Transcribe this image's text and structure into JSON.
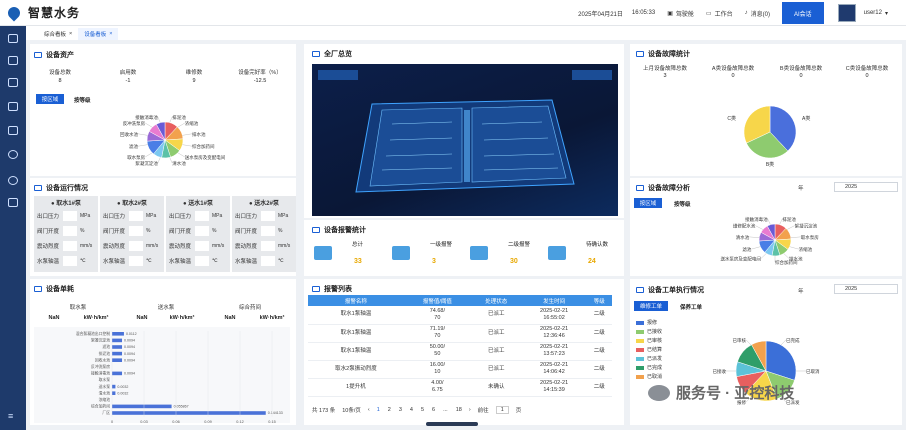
{
  "header": {
    "title": "智慧水务",
    "datetime": "2025年04月21日",
    "time": "16:05:33",
    "cockpit": "驾驶舱",
    "workbench": "工作台",
    "message": "消息(0)",
    "ai": "AI会话",
    "user": "user12"
  },
  "tabs": [
    {
      "label": "综合看板"
    },
    {
      "label": "设备看板"
    }
  ],
  "assets": {
    "title": "设备资产",
    "labels": [
      "设备总数",
      "启用数",
      "维修数",
      "设备完好率（%）"
    ],
    "values": [
      "8",
      "-1",
      "9",
      "-12.5"
    ],
    "btn_active": "按区域",
    "btn_other": "按等级",
    "pie": {
      "slices": [
        {
          "label": "絮凝沉淀池",
          "color": "#e85f5f",
          "value": 12
        },
        {
          "label": "取水泵房",
          "color": "#f2a14d",
          "value": 12
        },
        {
          "label": "清水池",
          "color": "#f7d64a",
          "value": 11
        },
        {
          "label": "排泥池",
          "color": "#8ecb6f",
          "value": 10
        },
        {
          "label": "回收水池",
          "color": "#5cc2a8",
          "value": 8
        },
        {
          "label": "浓缩池",
          "color": "#7cc8f0",
          "value": 8
        },
        {
          "label": "滤池",
          "color": "#4a7ee6",
          "value": 13
        },
        {
          "label": "综合加药间",
          "color": "#9a6ad6",
          "value": 9
        },
        {
          "label": "送水泵房及变配电间",
          "color": "#e87bd0",
          "value": 9
        },
        {
          "label": "反冲洗泵房",
          "color": "#6a5ad6",
          "value": 8
        }
      ],
      "labels": [
        "排泥池",
        "浓缩池",
        "排水池",
        "综合加药间",
        "送水泵房及变配电间",
        "清水池",
        "絮凝沉淀池",
        "取水泵房",
        "滤池",
        "回收水池",
        "反冲洗泵房",
        "接触消毒池"
      ]
    }
  },
  "ops": {
    "title": "设备运行情况",
    "pumps": [
      {
        "name": "取水1#泵",
        "rows": [
          [
            "出口压力",
            "MPa"
          ],
          [
            "阀门开度",
            "%"
          ],
          [
            "震动烈度",
            "mm/s"
          ],
          [
            "水泵轴温",
            "℃"
          ]
        ]
      },
      {
        "name": "取水2#泵",
        "rows": [
          [
            "出口压力",
            "MPa"
          ],
          [
            "阀门开度",
            "%"
          ],
          [
            "震动烈度",
            "mm/s"
          ],
          [
            "水泵轴温",
            "℃"
          ]
        ]
      },
      {
        "name": "送水1#泵",
        "rows": [
          [
            "出口压力",
            "MPa"
          ],
          [
            "阀门开度",
            "%"
          ],
          [
            "震动烈度",
            "mm/s"
          ],
          [
            "水泵轴温",
            "℃"
          ]
        ]
      },
      {
        "name": "送水2#泵",
        "rows": [
          [
            "出口压力",
            "MPa"
          ],
          [
            "阀门开度",
            "%"
          ],
          [
            "震动烈度",
            "mm/s"
          ],
          [
            "水泵轴温",
            "℃"
          ]
        ]
      }
    ]
  },
  "energy": {
    "title": "设备单耗",
    "groups": [
      "取水泵",
      "送水泵",
      "综合药间"
    ],
    "cols": [
      "NaN",
      "kW·h/km³",
      "NaN",
      "kW·h/km³",
      "NaN",
      "kW·h/km³"
    ],
    "chart_data": {
      "type": "bar",
      "orientation": "horizontal",
      "categories": [
        "混合絮凝池出口控制",
        "絮凝沉淀池",
        "滤池",
        "排泥池",
        "回收水池",
        "反冲洗泵房",
        "接触消毒池",
        "取水泵",
        "送水泵",
        "清水池",
        "浓缩池",
        "综合加药间",
        "厂区"
      ],
      "values": [
        0.0112,
        0.0094,
        0.0094,
        0.0094,
        0.0094,
        0.0,
        0.0094,
        0.0,
        0.0032,
        0.0032,
        0.0,
        0.055867,
        0.144133
      ],
      "labels": [
        "0.0112",
        "0.0094",
        "0.0094",
        "0.0094",
        "0.0094",
        "",
        "0.0094",
        "",
        "0.0032",
        "0.0032",
        "",
        "0.055867",
        "0.144133"
      ],
      "xticks": [
        "0",
        "0.03",
        "0.06",
        "0.09",
        "0.12",
        "0.15"
      ],
      "xlim": [
        0,
        0.15
      ]
    }
  },
  "overview": {
    "title": "全厂总览"
  },
  "alarm_stats": {
    "title": "设备报警统计",
    "items": [
      {
        "label": "总计",
        "value": "33"
      },
      {
        "label": "一级报警",
        "value": "3"
      },
      {
        "label": "二级报警",
        "value": "30"
      },
      {
        "label": "待确认数",
        "value": "24"
      }
    ]
  },
  "alarm_list": {
    "title": "报警列表",
    "headers": [
      "报警名称",
      "报警值/阈值",
      "处理状态",
      "发生时间",
      "等级"
    ],
    "rows": [
      [
        "取水1泵轴温",
        "74.68/\n70",
        "已派工",
        "2025-02-21\n16:55:02",
        "二级"
      ],
      [
        "取水1泵轴温",
        "71.19/\n70",
        "已派工",
        "2025-02-21\n12:36:46",
        "二级"
      ],
      [
        "取水1泵轴温",
        "50.00/\n50",
        "已派工",
        "2025-02-21\n13:57:23",
        "二级"
      ],
      [
        "取水2泵振动烈度",
        "16.00/\n10",
        "已派工",
        "2025-02-21\n14:06:42",
        "二级"
      ],
      [
        "1提升机",
        "4.00/\n6.75",
        "未确认",
        "2025-02-21\n14:15:39",
        "二级"
      ]
    ],
    "total": "共 173 条",
    "pagesize": "10条/页",
    "pages": [
      "1",
      "2",
      "3",
      "4",
      "5",
      "6",
      "...",
      "18"
    ],
    "goto": "前往",
    "page_input": "1",
    "page_unit": "页"
  },
  "fault_stats": {
    "title": "设备故障统计",
    "labels": [
      "上月设备故障总数",
      "A类设备故障总数",
      "B类设备故障总数",
      "C类设备故障总数"
    ],
    "values": [
      "3",
      "0",
      "0",
      "0"
    ],
    "pie": {
      "slices": [
        {
          "label": "A类",
          "color": "#4a6fdc",
          "value": 38
        },
        {
          "label": "B类",
          "color": "#8ecb6f",
          "value": 30
        },
        {
          "label": "C类",
          "color": "#f7d64a",
          "value": 32
        }
      ]
    }
  },
  "fault_analysis": {
    "title": "设备故障分析",
    "year_label": "年",
    "year": "2025",
    "btn_active": "按区域",
    "btn_other": "按等级",
    "pie_labels": [
      "排泥池",
      "絮凝沉淀池",
      "取水泵房",
      "浓缩池",
      "排水池",
      "综合加药间",
      "送水泵房及变配电间",
      "滤池",
      "清水池",
      "维修配水池",
      "接触消毒池"
    ]
  },
  "workorder": {
    "title": "设备工单执行情况",
    "year_label": "年",
    "year": "2025",
    "tab_active": "维修工单",
    "tab_other": "保养工单",
    "legend": [
      {
        "label": "报修",
        "color": "#3b6fd8"
      },
      {
        "label": "已接收",
        "color": "#8ecb6f"
      },
      {
        "label": "已审核",
        "color": "#f7d64a"
      },
      {
        "label": "已结算",
        "color": "#e85f5f"
      },
      {
        "label": "已派发",
        "color": "#5cc2d8"
      },
      {
        "label": "已完成",
        "color": "#2f9e6a"
      },
      {
        "label": "已取消",
        "color": "#f2a14d"
      }
    ],
    "pie_labels": [
      "已完成",
      "已取消",
      "已派发",
      "报修",
      "已接收",
      "已审核"
    ]
  },
  "watermark": "服务号 · 亚控科技"
}
